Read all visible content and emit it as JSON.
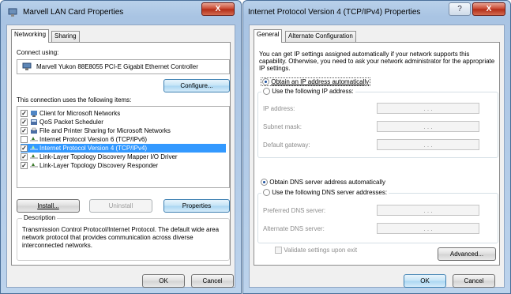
{
  "left_window": {
    "title": "Marvell LAN Card Properties",
    "close": "X",
    "tabs": [
      "Networking",
      "Sharing"
    ],
    "connect_using_label": "Connect using:",
    "adapter_name": "Marvell Yukon 88E8055 PCI-E Gigabit Ethernet Controller",
    "configure_button": "Configure...",
    "items_label": "This connection uses the following items:",
    "items": [
      {
        "label": "Client for Microsoft Networks",
        "checked": true,
        "icon": "network-client-icon"
      },
      {
        "label": "QoS Packet Scheduler",
        "checked": true,
        "icon": "scheduler-icon"
      },
      {
        "label": "File and Printer Sharing for Microsoft Networks",
        "checked": true,
        "icon": "printer-sharing-icon"
      },
      {
        "label": "Internet Protocol Version 6 (TCP/IPv6)",
        "checked": false,
        "icon": "protocol-icon"
      },
      {
        "label": "Internet Protocol Version 4 (TCP/IPv4)",
        "checked": true,
        "icon": "protocol-icon",
        "selected": true
      },
      {
        "label": "Link-Layer Topology Discovery Mapper I/O Driver",
        "checked": true,
        "icon": "protocol-icon"
      },
      {
        "label": "Link-Layer Topology Discovery Responder",
        "checked": true,
        "icon": "protocol-icon"
      }
    ],
    "install_button": "Install...",
    "uninstall_button": "Uninstall",
    "properties_button": "Properties",
    "description_title": "Description",
    "description_text": "Transmission Control Protocol/Internet Protocol. The default wide area network protocol that provides communication across diverse interconnected networks.",
    "ok_button": "OK",
    "cancel_button": "Cancel"
  },
  "right_window": {
    "title": "Internet Protocol Version 4 (TCP/IPv4) Properties",
    "help": "?",
    "close": "X",
    "tabs": [
      "General",
      "Alternate Configuration"
    ],
    "intro_text": "You can get IP settings assigned automatically if your network supports this capability. Otherwise, you need to ask your network administrator for the appropriate IP settings.",
    "obtain_ip_auto": "Obtain an IP address automatically",
    "use_following_ip": "Use the following IP address:",
    "ip_address_label": "IP address:",
    "subnet_mask_label": "Subnet mask:",
    "default_gateway_label": "Default gateway:",
    "ip_placeholder_dots": ". . .",
    "obtain_dns_auto": "Obtain DNS server address automatically",
    "use_following_dns": "Use the following DNS server addresses:",
    "preferred_dns_label": "Preferred DNS server:",
    "alternate_dns_label": "Alternate DNS server:",
    "validate_label": "Validate settings upon exit",
    "advanced_button": "Advanced...",
    "ok_button": "OK",
    "cancel_button": "Cancel"
  }
}
